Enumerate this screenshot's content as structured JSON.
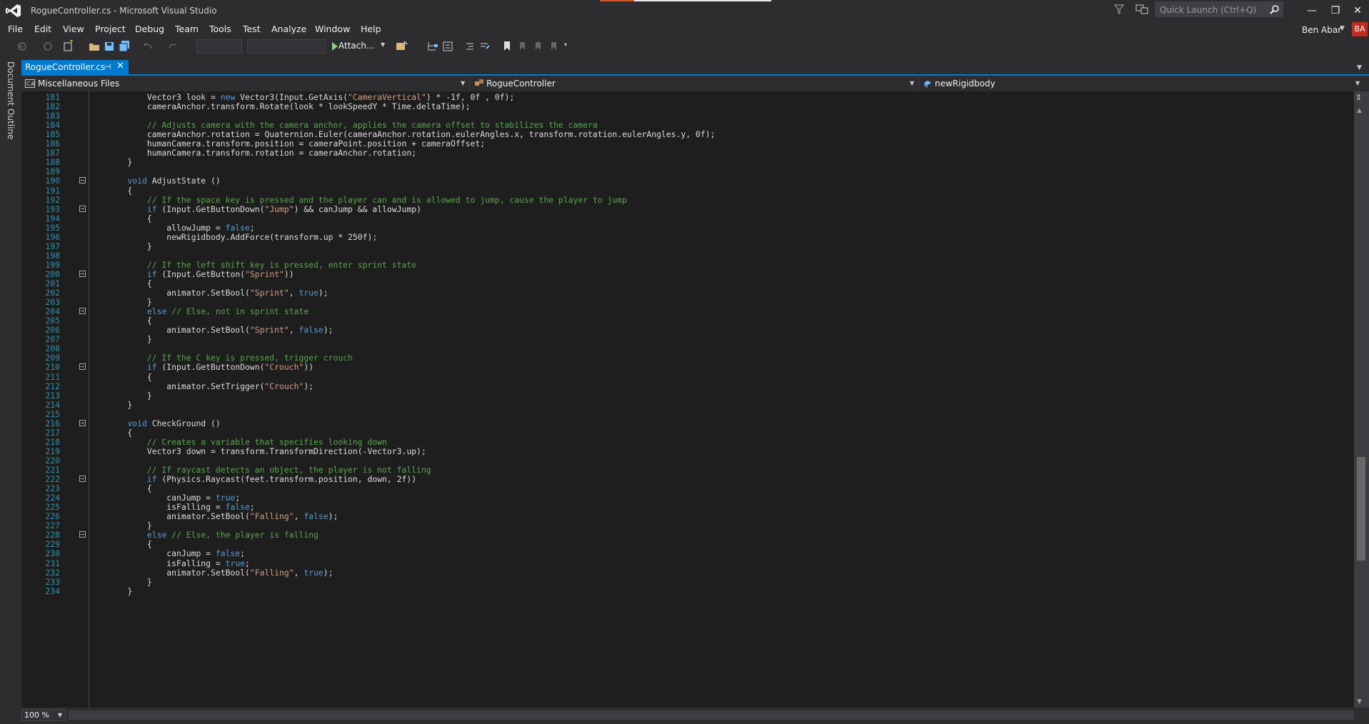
{
  "window": {
    "title": "RogueController.cs - Microsoft Visual Studio",
    "quick_launch_placeholder": "Quick Launch (Ctrl+Q)",
    "minimize": "—",
    "restore": "❐",
    "close": "✕"
  },
  "menu": [
    "File",
    "Edit",
    "View",
    "Project",
    "Debug",
    "Team",
    "Tools",
    "Test",
    "Analyze",
    "Window",
    "Help"
  ],
  "user": {
    "name": "Ben Abar",
    "initials": "BA",
    "avatar_color": "#c42b1c"
  },
  "toolbar": {
    "attach_label": "Attach..."
  },
  "side_panel": {
    "document_outline": "Document Outline"
  },
  "tab": {
    "file_name": "RogueController.cs"
  },
  "navbar": {
    "project": "Miscellaneous Files",
    "class": "RogueController",
    "member": "newRigidbody"
  },
  "editor": {
    "zoom": "100 %",
    "lines": [
      {
        "n": "181",
        "fold": false,
        "segs": [
          [
            "t",
            "        Vector3 look = "
          ],
          [
            "k",
            "new"
          ],
          [
            "t",
            " Vector3(Input.GetAxis("
          ],
          [
            "s",
            "\"CameraVertical\""
          ],
          [
            "t",
            ") * -1f, 0f , 0f);"
          ]
        ]
      },
      {
        "n": "182",
        "fold": false,
        "segs": [
          [
            "t",
            "        cameraAnchor.transform.Rotate(look * lookSpeedY * Time.deltaTime);"
          ]
        ]
      },
      {
        "n": "183",
        "fold": false,
        "segs": []
      },
      {
        "n": "184",
        "fold": false,
        "segs": [
          [
            "c",
            "        // Adjusts camera with the camera anchor, applies the camera offset to stabilizes the camera"
          ]
        ]
      },
      {
        "n": "185",
        "fold": false,
        "segs": [
          [
            "t",
            "        cameraAnchor.rotation = Quaternion.Euler(cameraAnchor.rotation.eulerAngles.x, transform.rotation.eulerAngles.y, 0f);"
          ]
        ]
      },
      {
        "n": "186",
        "fold": false,
        "segs": [
          [
            "t",
            "        humanCamera.transform.position = cameraPoint.position + cameraOffset;"
          ]
        ]
      },
      {
        "n": "187",
        "fold": false,
        "segs": [
          [
            "t",
            "        humanCamera.transform.rotation = cameraAnchor.rotation;"
          ]
        ]
      },
      {
        "n": "188",
        "fold": false,
        "segs": [
          [
            "t",
            "    }"
          ]
        ]
      },
      {
        "n": "189",
        "fold": false,
        "segs": []
      },
      {
        "n": "190",
        "fold": true,
        "segs": [
          [
            "t",
            "    "
          ],
          [
            "k",
            "void"
          ],
          [
            "t",
            " AdjustState ()"
          ]
        ]
      },
      {
        "n": "191",
        "fold": false,
        "segs": [
          [
            "t",
            "    {"
          ]
        ]
      },
      {
        "n": "192",
        "fold": false,
        "segs": [
          [
            "c",
            "        // If the space key is pressed and the player can and is allowed to jump, cause the player to jump"
          ]
        ]
      },
      {
        "n": "193",
        "fold": true,
        "segs": [
          [
            "t",
            "        "
          ],
          [
            "k",
            "if"
          ],
          [
            "t",
            " (Input.GetButtonDown("
          ],
          [
            "s",
            "\"Jump\""
          ],
          [
            "t",
            ") && canJump && allowJump)"
          ]
        ]
      },
      {
        "n": "194",
        "fold": false,
        "segs": [
          [
            "t",
            "        {"
          ]
        ]
      },
      {
        "n": "195",
        "fold": false,
        "segs": [
          [
            "t",
            "            allowJump = "
          ],
          [
            "k",
            "false"
          ],
          [
            "t",
            ";"
          ]
        ]
      },
      {
        "n": "196",
        "fold": false,
        "segs": [
          [
            "t",
            "            newRigidbody.AddForce(transform.up * 250f);"
          ]
        ]
      },
      {
        "n": "197",
        "fold": false,
        "segs": [
          [
            "t",
            "        }"
          ]
        ]
      },
      {
        "n": "198",
        "fold": false,
        "segs": []
      },
      {
        "n": "199",
        "fold": false,
        "segs": [
          [
            "c",
            "        // If the left shift key is pressed, enter sprint state"
          ]
        ]
      },
      {
        "n": "200",
        "fold": true,
        "segs": [
          [
            "t",
            "        "
          ],
          [
            "k",
            "if"
          ],
          [
            "t",
            " (Input.GetButton("
          ],
          [
            "s",
            "\"Sprint\""
          ],
          [
            "t",
            "))"
          ]
        ]
      },
      {
        "n": "201",
        "fold": false,
        "segs": [
          [
            "t",
            "        {"
          ]
        ]
      },
      {
        "n": "202",
        "fold": false,
        "segs": [
          [
            "t",
            "            animator.SetBool("
          ],
          [
            "s",
            "\"Sprint\""
          ],
          [
            "t",
            ", "
          ],
          [
            "k",
            "true"
          ],
          [
            "t",
            ");"
          ]
        ]
      },
      {
        "n": "203",
        "fold": false,
        "segs": [
          [
            "t",
            "        }"
          ]
        ]
      },
      {
        "n": "204",
        "fold": true,
        "segs": [
          [
            "t",
            "        "
          ],
          [
            "k",
            "else"
          ],
          [
            "t",
            " "
          ],
          [
            "c",
            "// Else, not in sprint state"
          ]
        ]
      },
      {
        "n": "205",
        "fold": false,
        "segs": [
          [
            "t",
            "        {"
          ]
        ]
      },
      {
        "n": "206",
        "fold": false,
        "segs": [
          [
            "t",
            "            animator.SetBool("
          ],
          [
            "s",
            "\"Sprint\""
          ],
          [
            "t",
            ", "
          ],
          [
            "k",
            "false"
          ],
          [
            "t",
            ");"
          ]
        ]
      },
      {
        "n": "207",
        "fold": false,
        "segs": [
          [
            "t",
            "        }"
          ]
        ]
      },
      {
        "n": "208",
        "fold": false,
        "segs": []
      },
      {
        "n": "209",
        "fold": false,
        "segs": [
          [
            "c",
            "        // If the C key is pressed, trigger crouch"
          ]
        ]
      },
      {
        "n": "210",
        "fold": true,
        "segs": [
          [
            "t",
            "        "
          ],
          [
            "k",
            "if"
          ],
          [
            "t",
            " (Input.GetButtonDown("
          ],
          [
            "s",
            "\"Crouch\""
          ],
          [
            "t",
            "))"
          ]
        ]
      },
      {
        "n": "211",
        "fold": false,
        "segs": [
          [
            "t",
            "        {"
          ]
        ]
      },
      {
        "n": "212",
        "fold": false,
        "segs": [
          [
            "t",
            "            animator.SetTrigger("
          ],
          [
            "s",
            "\"Crouch\""
          ],
          [
            "t",
            ");"
          ]
        ]
      },
      {
        "n": "213",
        "fold": false,
        "segs": [
          [
            "t",
            "        }"
          ]
        ]
      },
      {
        "n": "214",
        "fold": false,
        "segs": [
          [
            "t",
            "    }"
          ]
        ]
      },
      {
        "n": "215",
        "fold": false,
        "segs": []
      },
      {
        "n": "216",
        "fold": true,
        "segs": [
          [
            "t",
            "    "
          ],
          [
            "k",
            "void"
          ],
          [
            "t",
            " CheckGround ()"
          ]
        ]
      },
      {
        "n": "217",
        "fold": false,
        "segs": [
          [
            "t",
            "    {"
          ]
        ]
      },
      {
        "n": "218",
        "fold": false,
        "segs": [
          [
            "c",
            "        // Creates a variable that specifies looking down"
          ]
        ]
      },
      {
        "n": "219",
        "fold": false,
        "segs": [
          [
            "t",
            "        Vector3 down = transform.TransformDirection(-Vector3.up);"
          ]
        ]
      },
      {
        "n": "220",
        "fold": false,
        "segs": []
      },
      {
        "n": "221",
        "fold": false,
        "segs": [
          [
            "c",
            "        // If raycast detects an object, the player is not falling"
          ]
        ]
      },
      {
        "n": "222",
        "fold": true,
        "segs": [
          [
            "t",
            "        "
          ],
          [
            "k",
            "if"
          ],
          [
            "t",
            " (Physics.Raycast(feet.transform.position, down, 2f))"
          ]
        ]
      },
      {
        "n": "223",
        "fold": false,
        "segs": [
          [
            "t",
            "        {"
          ]
        ]
      },
      {
        "n": "224",
        "fold": false,
        "segs": [
          [
            "t",
            "            canJump = "
          ],
          [
            "k",
            "true"
          ],
          [
            "t",
            ";"
          ]
        ]
      },
      {
        "n": "225",
        "fold": false,
        "segs": [
          [
            "t",
            "            isFalling = "
          ],
          [
            "k",
            "false"
          ],
          [
            "t",
            ";"
          ]
        ]
      },
      {
        "n": "226",
        "fold": false,
        "segs": [
          [
            "t",
            "            animator.SetBool("
          ],
          [
            "s",
            "\"Falling\""
          ],
          [
            "t",
            ", "
          ],
          [
            "k",
            "false"
          ],
          [
            "t",
            ");"
          ]
        ]
      },
      {
        "n": "227",
        "fold": false,
        "segs": [
          [
            "t",
            "        }"
          ]
        ]
      },
      {
        "n": "228",
        "fold": true,
        "segs": [
          [
            "t",
            "        "
          ],
          [
            "k",
            "else"
          ],
          [
            "t",
            " "
          ],
          [
            "c",
            "// Else, the player is falling"
          ]
        ]
      },
      {
        "n": "229",
        "fold": false,
        "segs": [
          [
            "t",
            "        {"
          ]
        ]
      },
      {
        "n": "230",
        "fold": false,
        "segs": [
          [
            "t",
            "            canJump = "
          ],
          [
            "k",
            "false"
          ],
          [
            "t",
            ";"
          ]
        ]
      },
      {
        "n": "231",
        "fold": false,
        "segs": [
          [
            "t",
            "            isFalling = "
          ],
          [
            "k",
            "true"
          ],
          [
            "t",
            ";"
          ]
        ]
      },
      {
        "n": "232",
        "fold": false,
        "segs": [
          [
            "t",
            "            animator.SetBool("
          ],
          [
            "s",
            "\"Falling\""
          ],
          [
            "t",
            ", "
          ],
          [
            "k",
            "true"
          ],
          [
            "t",
            ");"
          ]
        ]
      },
      {
        "n": "233",
        "fold": false,
        "segs": [
          [
            "t",
            "        }"
          ]
        ]
      },
      {
        "n": "234",
        "fold": false,
        "segs": [
          [
            "t",
            "    }"
          ]
        ]
      }
    ]
  },
  "colors": {
    "accent": "#007acc",
    "keyword": "#569cd6",
    "string": "#d69d85",
    "comment": "#57a64a",
    "line_number": "#2b91af"
  }
}
